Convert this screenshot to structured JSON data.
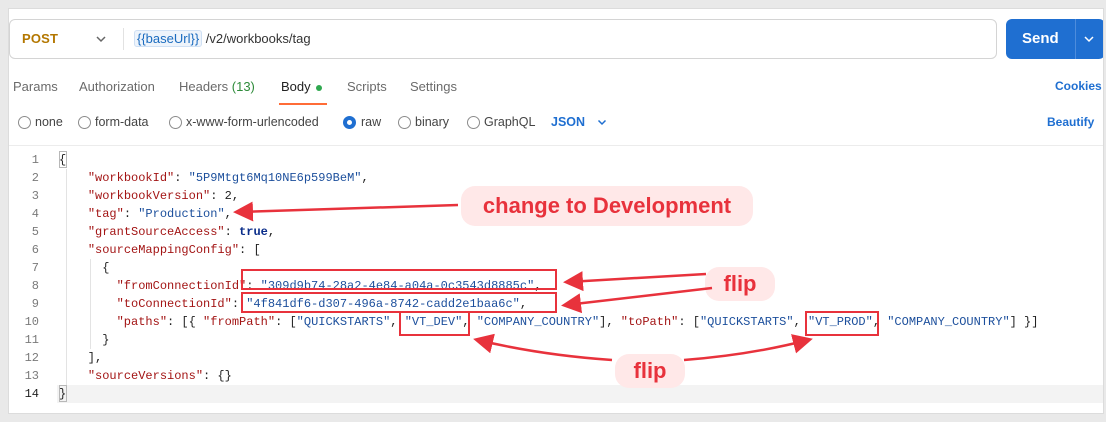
{
  "request": {
    "method": "POST",
    "url_variable": "{{baseUrl}}",
    "url_path": "/v2/workbooks/tag",
    "send_label": "Send"
  },
  "tabs": {
    "params": "Params",
    "authorization": "Authorization",
    "headers_label": "Headers",
    "headers_count": "(13)",
    "body": "Body",
    "scripts": "Scripts",
    "settings": "Settings",
    "cookies": "Cookies"
  },
  "body_types": {
    "none": "none",
    "form_data": "form-data",
    "urlencoded": "x-www-form-urlencoded",
    "raw": "raw",
    "binary": "binary",
    "graphql": "GraphQL",
    "selected": "raw",
    "format": "JSON",
    "beautify": "Beautify"
  },
  "editor": {
    "line_numbers": [
      "1",
      "2",
      "3",
      "4",
      "5",
      "6",
      "7",
      "8",
      "9",
      "10",
      "11",
      "12",
      "13",
      "14"
    ],
    "current_line": 14
  },
  "annotations": {
    "change_to_development": "change to Development",
    "flip_top": "flip",
    "flip_bottom": "flip"
  },
  "colors": {
    "accent": "#1f6fd1",
    "method": "#b37700",
    "annotation": "#e8323c",
    "annotation_bg": "#ffe8e8",
    "tab_active_underline": "#ff6c37"
  }
}
